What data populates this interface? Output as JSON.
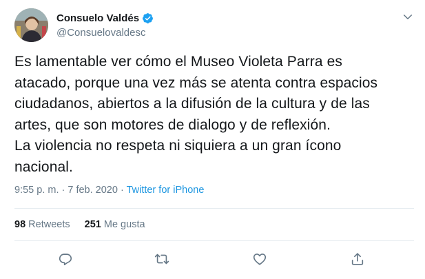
{
  "user": {
    "name": "Consuelo Valdés",
    "handle": "@Consuelovaldesc"
  },
  "tweet": {
    "lines": [
      "Es lamentable ver cómo el Museo Violeta Parra es",
      "atacado, porque una vez más se atenta contra espacios",
      "ciudadanos, abiertos a la difusión de la cultura y de las",
      "artes, que son motores de dialogo y de reflexión.",
      "La violencia no respeta ni siquiera a un gran ícono",
      "nacional."
    ]
  },
  "meta": {
    "timestamp": "9:55 p. m. · 7 feb. 2020",
    "separator": " · ",
    "source": "Twitter for iPhone"
  },
  "stats": {
    "retweets_count": "98",
    "retweets_label": "Retweets",
    "likes_count": "251",
    "likes_label": "Me gusta"
  },
  "icons": {
    "verified": "verified-badge-icon",
    "caret": "chevron-down-icon",
    "reply": "reply-icon",
    "retweet": "retweet-icon",
    "like": "heart-icon",
    "share": "share-icon"
  },
  "colors": {
    "accent": "#1da1f2",
    "link": "#1b95e0",
    "secondary_text": "#657786",
    "primary_text": "#14171a",
    "divider": "#e6ecf0"
  }
}
